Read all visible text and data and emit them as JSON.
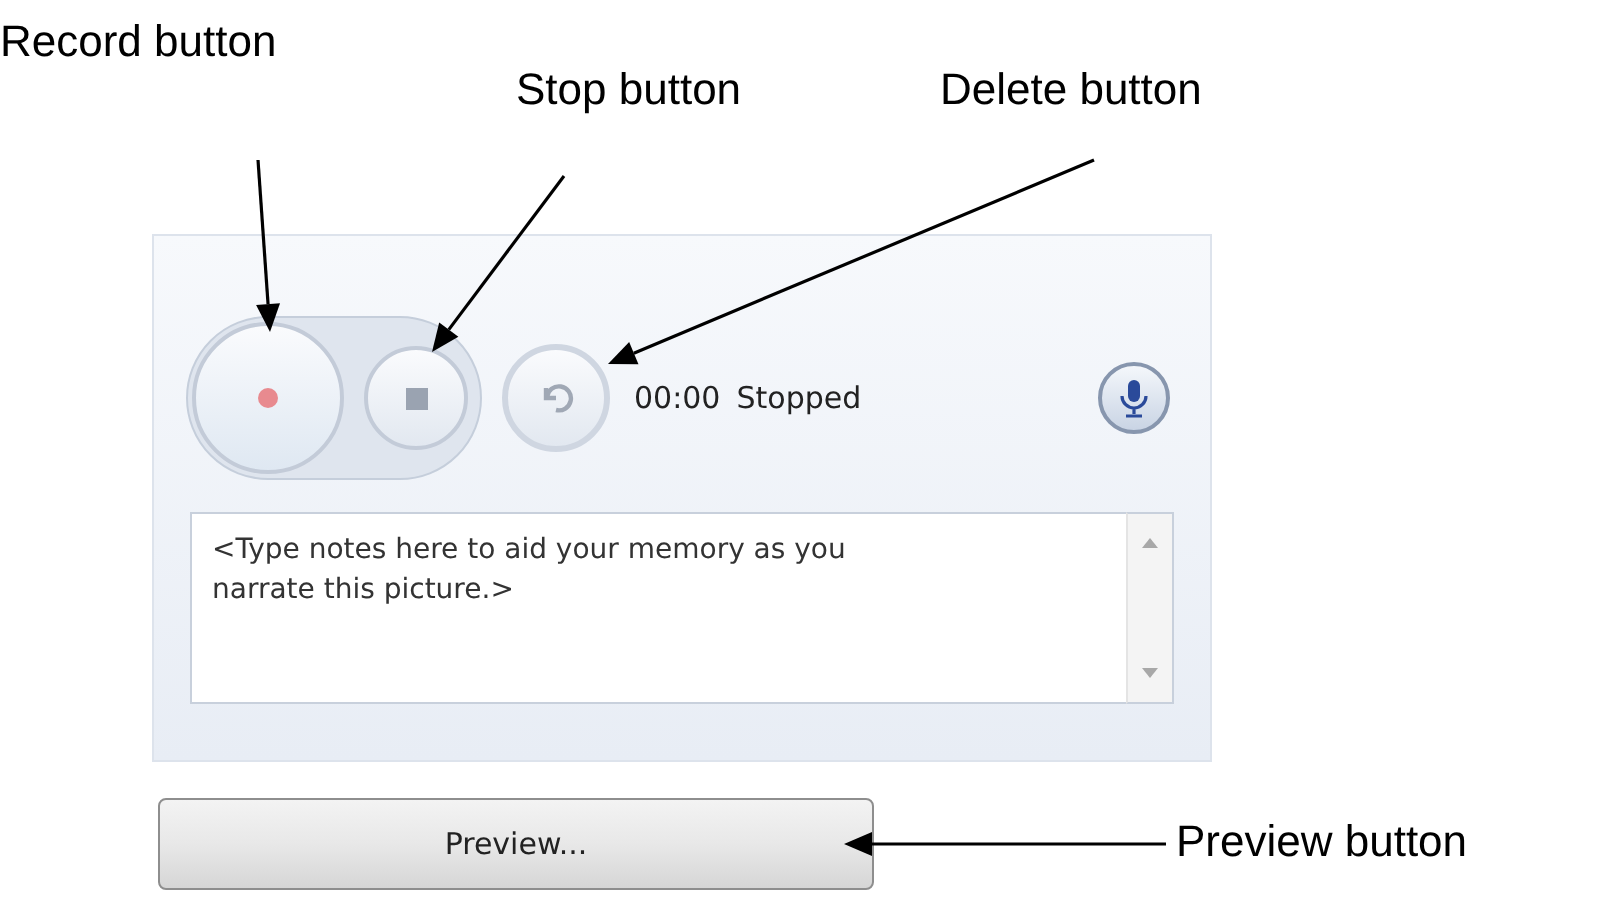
{
  "callouts": [
    {
      "label": "Record button"
    },
    {
      "label": "Stop button"
    },
    {
      "label": "Delete button"
    },
    {
      "label": "Preview button"
    }
  ],
  "recorder": {
    "time": "00:00",
    "status": "Stopped",
    "notes": {
      "placeholder": "<Type notes here to aid your memory as you narrate this picture.>"
    }
  },
  "preview_button": {
    "label": "Preview..."
  }
}
